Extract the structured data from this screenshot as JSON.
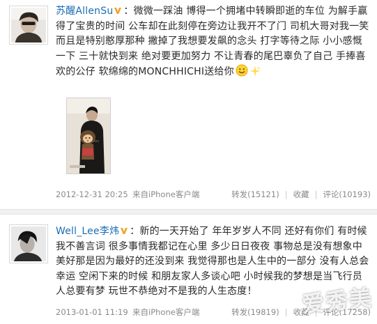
{
  "posts": [
    {
      "username": "苏醒AllenSu",
      "verified": true,
      "text": "：微微一踩油 博得一个拥堵中转瞬即逝的车位 为解手赢得了宝贵的时间 公车却在此刻停在旁边让我开不了门 司机大哥对我一笑 而且是特别憨厚那种 撇掉了我想要发飙的念头 打字等待之际 小小感慨一下 三十就快到来 绝对要更加努力 不让青春的尾巴辜负了自己 手捧喜欢的公仔 软绵绵的MONCHHICHI送给你",
      "has_photo": true,
      "time": "2012-12-31 20:25",
      "source": "来自iPhone客户端",
      "repost_label": "转发(15121)",
      "fav_label": "收藏",
      "comment_label": "评论(10193)"
    },
    {
      "username": "Well_Lee李炜",
      "verified": true,
      "text": "：新的一天开始了 年年岁岁人不同 还好有你们 有时候我不善言词 很多事情我都记在心里 多少日日夜夜 事物总是没有想象中美好那是因为最好的还没到来 我觉得那也是人生中的一部分 没有人总会幸运 空闲下来的时候 和朋友家人多谈心吧 小时候我的梦想是当飞行员 人总要有梦 玩世不恭绝对不是我的人生态度！",
      "time": "2013-01-01 11:19",
      "source": "来自iPhone客户端",
      "repost_label": "转发(19819)",
      "fav_label": "收藏",
      "comment_label": "评论(17258)"
    }
  ],
  "watermark": "爱秀美",
  "colors": {
    "username": "#1b6db3",
    "meta": "#8a8a8a",
    "vbadge": "#f0a22a"
  }
}
